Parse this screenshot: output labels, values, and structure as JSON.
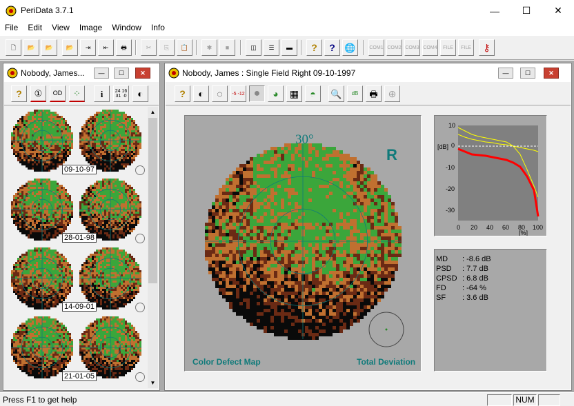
{
  "app": {
    "title": "PeriData 3.7.1"
  },
  "window_controls": {
    "minimize": "—",
    "maximize": "☐",
    "close": "✕"
  },
  "menu": [
    {
      "id": "file",
      "label": "File"
    },
    {
      "id": "edit",
      "label": "Edit"
    },
    {
      "id": "view",
      "label": "View"
    },
    {
      "id": "image",
      "label": "Image"
    },
    {
      "id": "window",
      "label": "Window"
    },
    {
      "id": "info",
      "label": "Info"
    }
  ],
  "toolbar": {
    "buttons": [
      {
        "name": "new",
        "glyph": "🗋"
      },
      {
        "name": "open",
        "glyph": "📂"
      },
      {
        "name": "open-green",
        "glyph": "📂"
      },
      {
        "name": "open-disabled",
        "glyph": "📂",
        "disabled": true
      },
      {
        "name": "import",
        "glyph": "⇥"
      },
      {
        "name": "export",
        "glyph": "⇤"
      },
      {
        "name": "print",
        "glyph": "🖶"
      },
      {
        "name": "cut",
        "glyph": "✂",
        "disabled": true
      },
      {
        "name": "copy",
        "glyph": "⎘",
        "disabled": true
      },
      {
        "name": "paste",
        "glyph": "📋",
        "disabled": true
      },
      {
        "name": "bug",
        "glyph": "✱",
        "disabled": true
      },
      {
        "name": "gray-box",
        "glyph": "■",
        "disabled": true
      },
      {
        "name": "split-vertical",
        "glyph": "◫"
      },
      {
        "name": "split-horizontal",
        "glyph": "☰"
      },
      {
        "name": "monitor",
        "glyph": "▬"
      },
      {
        "name": "help",
        "glyph": "?"
      },
      {
        "name": "context-help",
        "glyph": "?"
      },
      {
        "name": "web",
        "glyph": "🌐"
      },
      {
        "name": "com1",
        "glyph": "COM1",
        "disabled": true
      },
      {
        "name": "com2",
        "glyph": "COM2",
        "disabled": true
      },
      {
        "name": "com3",
        "glyph": "COM3",
        "disabled": true
      },
      {
        "name": "com4",
        "glyph": "COM4",
        "disabled": true
      },
      {
        "name": "file1",
        "glyph": "FILE",
        "disabled": true
      },
      {
        "name": "file2",
        "glyph": "FILE",
        "disabled": true
      },
      {
        "name": "key",
        "glyph": "⚷"
      }
    ]
  },
  "left_window": {
    "title": "Nobody, James...",
    "toolbar": [
      {
        "name": "help",
        "glyph": "?"
      },
      {
        "name": "one",
        "glyph": "①"
      },
      {
        "name": "od",
        "glyph": "OD"
      },
      {
        "name": "scatter",
        "glyph": "⁘"
      },
      {
        "name": "info",
        "glyph": "i"
      },
      {
        "name": "numbers",
        "glyph": "24 16 31 ·0"
      },
      {
        "name": "grayscale",
        "glyph": "◐"
      }
    ],
    "dates": [
      "09-10-97",
      "28-01-98",
      "14-09-01",
      "21-01-05"
    ]
  },
  "right_window": {
    "title": "Nobody, James :  Single Field  Right  09-10-1997",
    "toolbar": [
      {
        "name": "help",
        "glyph": "?"
      },
      {
        "name": "grayscale",
        "glyph": "◐"
      },
      {
        "name": "dots",
        "glyph": "◌"
      },
      {
        "name": "numbers",
        "glyph": "-5 -12"
      },
      {
        "name": "circle",
        "glyph": "●"
      },
      {
        "name": "color",
        "glyph": "◕"
      },
      {
        "name": "grid",
        "glyph": "▦"
      },
      {
        "name": "hill",
        "glyph": "◓"
      },
      {
        "name": "zoom",
        "glyph": "🔍"
      },
      {
        "name": "db-chart",
        "glyph": "dB"
      },
      {
        "name": "print",
        "glyph": "🖶"
      },
      {
        "name": "crosshair",
        "glyph": "⊕",
        "disabled": true
      }
    ],
    "map": {
      "angle_label": "30°",
      "eye_label": "R",
      "left_caption": "Color Defect Map",
      "right_caption": "Total Deviation"
    },
    "bebie": {
      "y_axis_unit": "[dB]",
      "x_axis_unit": "[%]",
      "y_ticks": [
        "10",
        "0",
        "-10",
        "-20",
        "-30"
      ],
      "x_ticks": [
        "0",
        "20",
        "40",
        "60",
        "80",
        "100"
      ]
    },
    "stats": [
      {
        "label": "MD",
        "value": "-8.6 dB"
      },
      {
        "label": "PSD",
        "value": "7.7 dB"
      },
      {
        "label": "CPSD",
        "value": "6.8 dB"
      },
      {
        "label": "FD",
        "value": "-64 %"
      },
      {
        "label": "SF",
        "value": "3.6 dB"
      }
    ]
  },
  "colors": {
    "normal": "#3ba63b",
    "mild": "#c07030",
    "moderate": "#6a2a14",
    "severe": "#0a0a0a",
    "accent": "#0f7a7a"
  },
  "status": {
    "help_text": "Press F1 to get help",
    "num": "NUM"
  }
}
